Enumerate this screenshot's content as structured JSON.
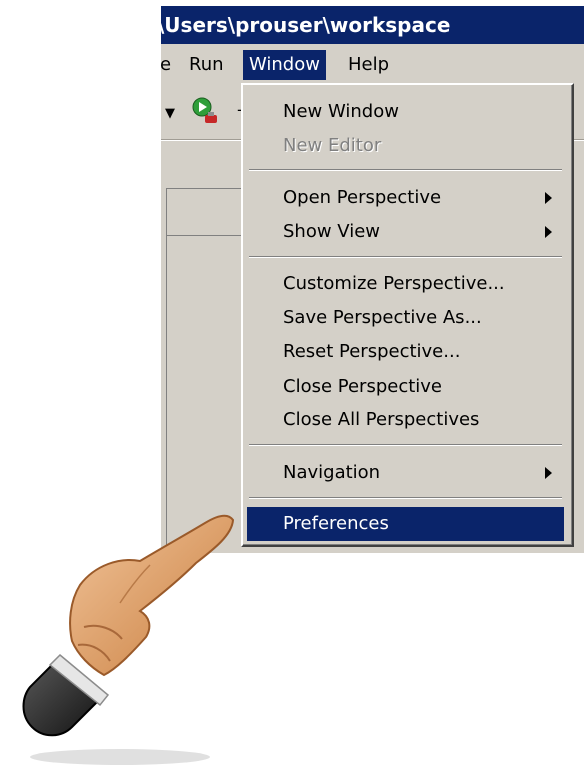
{
  "window": {
    "title": "\\Users\\prouser\\workspace"
  },
  "menubar": [
    {
      "label": "e"
    },
    {
      "label": "Run"
    },
    {
      "label": "Window"
    },
    {
      "label": "Help"
    }
  ],
  "toolbar": {
    "dropdown_icon": "dropdown-arrow-icon",
    "run_icon": "run-external-tool-icon"
  },
  "window_menu": {
    "items": [
      {
        "label": "New Window"
      },
      {
        "label": "New Editor"
      },
      {
        "label": "Open Perspective"
      },
      {
        "label": "Show View"
      },
      {
        "label": "Customize Perspective..."
      },
      {
        "label": "Save Perspective As..."
      },
      {
        "label": "Reset Perspective..."
      },
      {
        "label": "Close Perspective"
      },
      {
        "label": "Close All Perspectives"
      },
      {
        "label": "Navigation"
      },
      {
        "label": "Preferences"
      }
    ],
    "highlighted_item": "Preferences",
    "highlight_color": "#0a246a"
  },
  "pointer": {
    "icon": "pointing-hand-icon"
  }
}
